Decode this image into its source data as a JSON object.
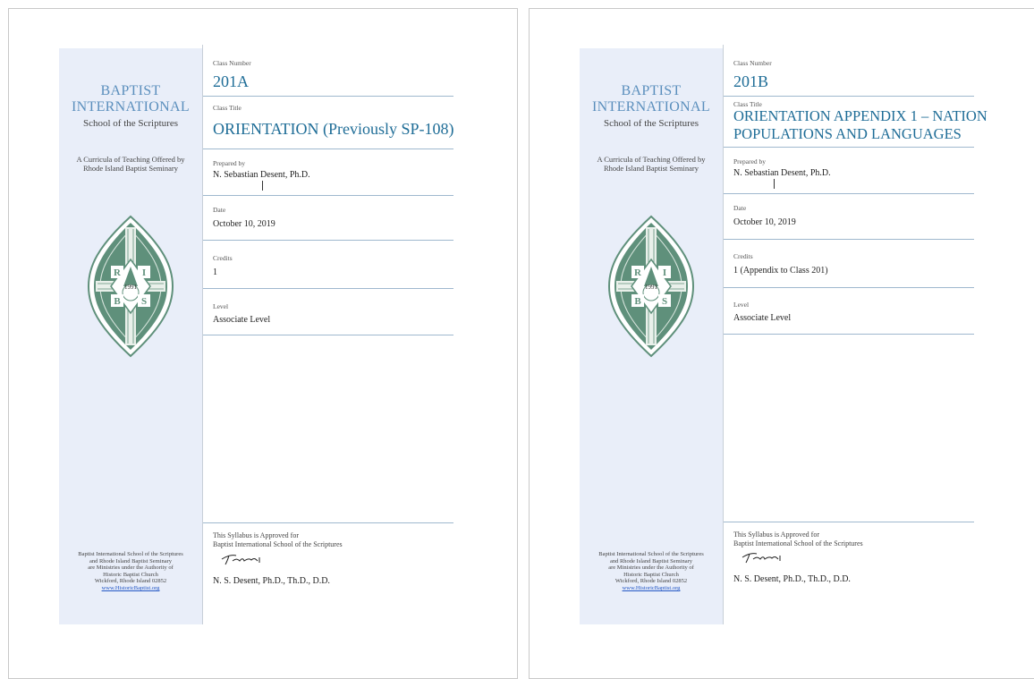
{
  "colors": {
    "sidebar_bg": "#e9eef9",
    "title_blue": "#1f6d97",
    "sidebar_title_blue": "#5b8fbd",
    "seal_green": "#5f907b"
  },
  "sidebar": {
    "title_line1": "BAPTIST",
    "title_line2": "INTERNATIONAL",
    "subtitle": "School of the Scriptures",
    "desc_line1": "A Curricula of Teaching Offered by",
    "desc_line2": "Rhode Island Baptist Seminary",
    "seal": {
      "letters": [
        "R",
        "I",
        "B",
        "S"
      ],
      "year": "1991"
    },
    "footer": {
      "line1": "Baptist International School of the Scriptures",
      "line2": "and Rhode Island Baptist Seminary",
      "line3": "are Ministries under the Authority of",
      "line4": "Historic Baptist Church",
      "line5": "Wickford, Rhode Island 02852",
      "link": "www.HistoricBaptist.org"
    }
  },
  "labels": {
    "class_number": "Class Number",
    "class_title": "Class Title",
    "prepared_by": "Prepared by",
    "date": "Date",
    "credits": "Credits",
    "level": "Level"
  },
  "approval": {
    "line1": "This Syllabus is Approved for",
    "line2": "Baptist International School of the Scriptures",
    "signer": "N. S. Desent, Ph.D., Th.D., D.D."
  },
  "pages": [
    {
      "class_number": "201A",
      "class_title_line1": "ORIENTATION (Previously SP-108)",
      "class_title_line2": "",
      "prepared_by": "N. Sebastian Desent, Ph.D.",
      "date": "October 10, 2019",
      "credits": "1",
      "level": "Associate Level"
    },
    {
      "class_number": "201B",
      "class_title_line1": "ORIENTATION APPENDIX 1 – NATION",
      "class_title_line2": "POPULATIONS AND LANGUAGES",
      "prepared_by": "N. Sebastian Desent, Ph.D.",
      "date": "October 10, 2019",
      "credits": "1 (Appendix to Class 201)",
      "level": "Associate Level"
    }
  ]
}
